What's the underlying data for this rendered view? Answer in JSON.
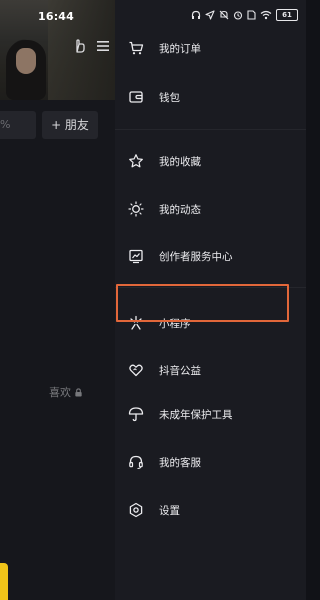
{
  "status_bar": {
    "time": "16:44",
    "battery": "61"
  },
  "profile_background": {
    "search_fragment": "%",
    "add_friend": "+ 朋友",
    "likes": "喜欢"
  },
  "drawer": {
    "items": [
      {
        "label": "我的订单",
        "icon": "cart-icon"
      },
      {
        "label": "钱包",
        "icon": "wallet-icon"
      },
      {
        "label": "我的收藏",
        "icon": "star-icon"
      },
      {
        "label": "我的动态",
        "icon": "sun-icon"
      },
      {
        "label": "创作者服务中心",
        "icon": "chart-icon"
      },
      {
        "label": "小程序",
        "icon": "mini-program-icon"
      },
      {
        "label": "抖音公益",
        "icon": "heart-hands-icon"
      },
      {
        "label": "未成年保护工具",
        "icon": "umbrella-icon"
      },
      {
        "label": "我的客服",
        "icon": "headset-icon"
      },
      {
        "label": "设置",
        "icon": "gear-icon"
      }
    ],
    "highlighted_item": "未成年保护工具"
  },
  "colors": {
    "highlight": "#e2673a",
    "drawer_bg": "#1a1b21",
    "accent_tab": "#f0c419"
  }
}
